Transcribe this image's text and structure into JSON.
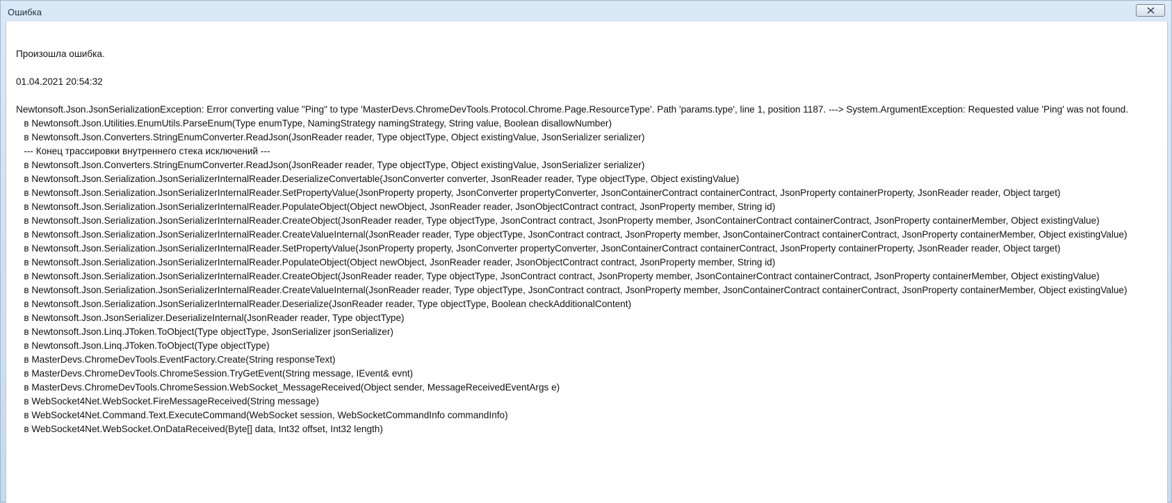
{
  "window": {
    "title": "Ошибка",
    "close_label": "close"
  },
  "message": {
    "heading": "Произошла ошибка.",
    "timestamp": "01.04.2021 20:54:32",
    "exception": "Newtonsoft.Json.JsonSerializationException: Error converting value \"Ping\" to type 'MasterDevs.ChromeDevTools.Protocol.Chrome.Page.ResourceType'. Path 'params.type', line 1, position 1187. ---> System.ArgumentException: Requested value 'Ping' was not found."
  },
  "stack": [
    "   в Newtonsoft.Json.Utilities.EnumUtils.ParseEnum(Type enumType, NamingStrategy namingStrategy, String value, Boolean disallowNumber)",
    "   в Newtonsoft.Json.Converters.StringEnumConverter.ReadJson(JsonReader reader, Type objectType, Object existingValue, JsonSerializer serializer)",
    "   --- Конец трассировки внутреннего стека исключений ---",
    "   в Newtonsoft.Json.Converters.StringEnumConverter.ReadJson(JsonReader reader, Type objectType, Object existingValue, JsonSerializer serializer)",
    "   в Newtonsoft.Json.Serialization.JsonSerializerInternalReader.DeserializeConvertable(JsonConverter converter, JsonReader reader, Type objectType, Object existingValue)",
    "   в Newtonsoft.Json.Serialization.JsonSerializerInternalReader.SetPropertyValue(JsonProperty property, JsonConverter propertyConverter, JsonContainerContract containerContract, JsonProperty containerProperty, JsonReader reader, Object target)",
    "   в Newtonsoft.Json.Serialization.JsonSerializerInternalReader.PopulateObject(Object newObject, JsonReader reader, JsonObjectContract contract, JsonProperty member, String id)",
    "   в Newtonsoft.Json.Serialization.JsonSerializerInternalReader.CreateObject(JsonReader reader, Type objectType, JsonContract contract, JsonProperty member, JsonContainerContract containerContract, JsonProperty containerMember, Object existingValue)",
    "   в Newtonsoft.Json.Serialization.JsonSerializerInternalReader.CreateValueInternal(JsonReader reader, Type objectType, JsonContract contract, JsonProperty member, JsonContainerContract containerContract, JsonProperty containerMember, Object existingValue)",
    "   в Newtonsoft.Json.Serialization.JsonSerializerInternalReader.SetPropertyValue(JsonProperty property, JsonConverter propertyConverter, JsonContainerContract containerContract, JsonProperty containerProperty, JsonReader reader, Object target)",
    "   в Newtonsoft.Json.Serialization.JsonSerializerInternalReader.PopulateObject(Object newObject, JsonReader reader, JsonObjectContract contract, JsonProperty member, String id)",
    "   в Newtonsoft.Json.Serialization.JsonSerializerInternalReader.CreateObject(JsonReader reader, Type objectType, JsonContract contract, JsonProperty member, JsonContainerContract containerContract, JsonProperty containerMember, Object existingValue)",
    "   в Newtonsoft.Json.Serialization.JsonSerializerInternalReader.CreateValueInternal(JsonReader reader, Type objectType, JsonContract contract, JsonProperty member, JsonContainerContract containerContract, JsonProperty containerMember, Object existingValue)",
    "   в Newtonsoft.Json.Serialization.JsonSerializerInternalReader.Deserialize(JsonReader reader, Type objectType, Boolean checkAdditionalContent)",
    "   в Newtonsoft.Json.JsonSerializer.DeserializeInternal(JsonReader reader, Type objectType)",
    "   в Newtonsoft.Json.Linq.JToken.ToObject(Type objectType, JsonSerializer jsonSerializer)",
    "   в Newtonsoft.Json.Linq.JToken.ToObject(Type objectType)",
    "   в MasterDevs.ChromeDevTools.EventFactory.Create(String responseText)",
    "   в MasterDevs.ChromeDevTools.ChromeSession.TryGetEvent(String message, IEvent& evnt)",
    "   в MasterDevs.ChromeDevTools.ChromeSession.WebSocket_MessageReceived(Object sender, MessageReceivedEventArgs e)",
    "   в WebSocket4Net.WebSocket.FireMessageReceived(String message)",
    "   в WebSocket4Net.Command.Text.ExecuteCommand(WebSocket session, WebSocketCommandInfo commandInfo)",
    "   в WebSocket4Net.WebSocket.OnDataReceived(Byte[] data, Int32 offset, Int32 length)"
  ]
}
